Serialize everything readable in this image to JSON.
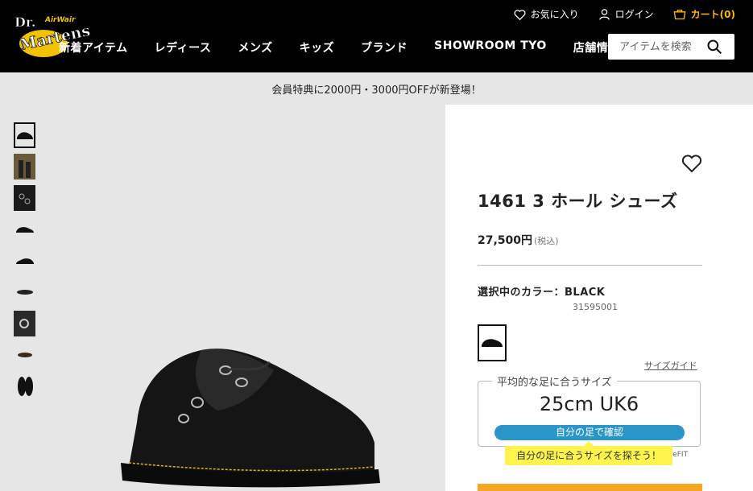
{
  "header": {
    "logo_text": "Dr. Martens AirWair",
    "links": {
      "favorites": "お気に入り",
      "login": "ログイン",
      "cart": "カート(0)"
    },
    "nav": [
      "新着アイテム",
      "レディース",
      "メンズ",
      "キッズ",
      "ブランド",
      "SHOWROOM TYO",
      "店舗情報"
    ],
    "search_placeholder": "アイテムを検索"
  },
  "banner": {
    "text": "会員特典に2000円・3000円OFFが新登場！"
  },
  "product": {
    "name": "1461 3 ホール シューズ",
    "price": "27,500円",
    "tax_note": "(税込)",
    "color_label": "選択中のカラー：BLACK",
    "color_code": "31595001",
    "size_guide": "サイズガイド"
  },
  "fit": {
    "title": "平均的な足に合うサイズ",
    "size": "25cm UK6",
    "button": "自分の足で確認",
    "tooltip": "自分の足に合うサイズを探そう！",
    "brand": "ureFIT"
  },
  "colors": {
    "accent": "#ffb800",
    "fit_button": "#2a95c9",
    "tooltip": "#fff34d",
    "cta": "#f5a623"
  }
}
